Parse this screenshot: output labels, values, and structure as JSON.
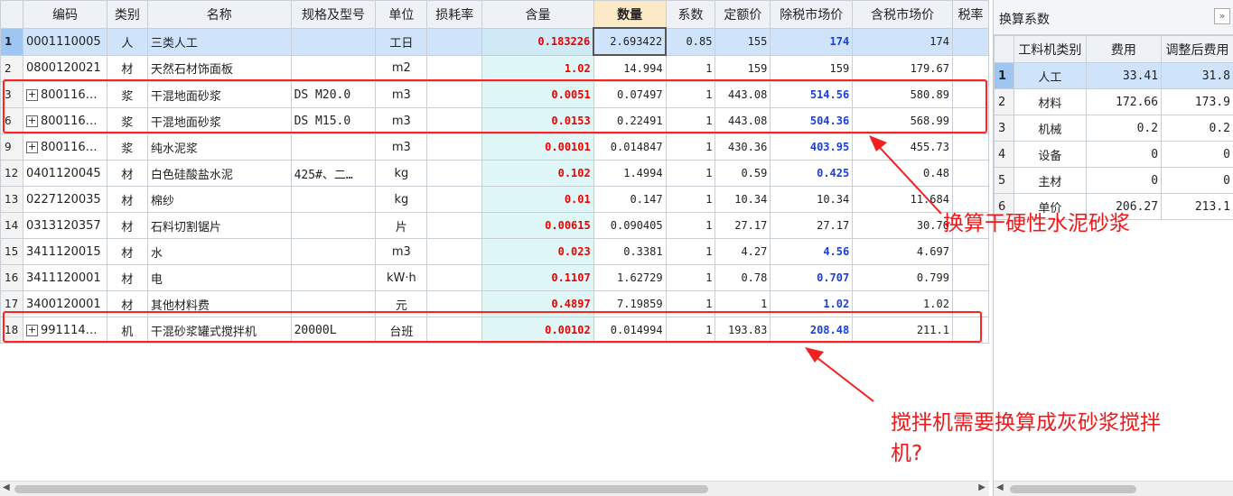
{
  "table": {
    "headers": [
      "编码",
      "类别",
      "名称",
      "规格及型号",
      "单位",
      "损耗率",
      "含量",
      "数量",
      "系数",
      "定额价",
      "除税市场价",
      "含税市场价",
      "税率"
    ],
    "rows": [
      {
        "no": "1",
        "code": "0001110005",
        "expand": false,
        "type": "人",
        "name": "三类人工",
        "spec": "",
        "unit": "工日",
        "loss": "",
        "content": "0.183226",
        "qty": "2.693422",
        "coef": "0.85",
        "quota": "155",
        "mkt_ex": "174",
        "mkt_ex_hl": true,
        "mkt_in": "174"
      },
      {
        "no": "2",
        "code": "0800120021",
        "expand": false,
        "type": "材",
        "name": "天然石材饰面板",
        "spec": "",
        "unit": "m2",
        "loss": "",
        "content": "1.02",
        "qty": "14.994",
        "coef": "1",
        "quota": "159",
        "mkt_ex": "159",
        "mkt_ex_hl": false,
        "mkt_in": "179.67"
      },
      {
        "no": "3",
        "code": "800116…",
        "expand": true,
        "type": "浆",
        "name": "干混地面砂浆",
        "spec": "DS M20.0",
        "unit": "m3",
        "loss": "",
        "content": "0.0051",
        "qty": "0.07497",
        "coef": "1",
        "quota": "443.08",
        "mkt_ex": "514.56",
        "mkt_ex_hl": true,
        "mkt_in": "580.89"
      },
      {
        "no": "6",
        "code": "800116…",
        "expand": true,
        "type": "浆",
        "name": "干混地面砂浆",
        "spec": "DS M15.0",
        "unit": "m3",
        "loss": "",
        "content": "0.0153",
        "qty": "0.22491",
        "coef": "1",
        "quota": "443.08",
        "mkt_ex": "504.36",
        "mkt_ex_hl": true,
        "mkt_in": "568.99"
      },
      {
        "no": "9",
        "code": "800116…",
        "expand": true,
        "type": "浆",
        "name": "纯水泥浆",
        "spec": "",
        "unit": "m3",
        "loss": "",
        "content": "0.00101",
        "qty": "0.014847",
        "coef": "1",
        "quota": "430.36",
        "mkt_ex": "403.95",
        "mkt_ex_hl": true,
        "mkt_in": "455.73"
      },
      {
        "no": "12",
        "code": "0401120045",
        "expand": false,
        "type": "材",
        "name": "白色硅酸盐水泥",
        "spec": "425#、二…",
        "unit": "kg",
        "loss": "",
        "content": "0.102",
        "qty": "1.4994",
        "coef": "1",
        "quota": "0.59",
        "mkt_ex": "0.425",
        "mkt_ex_hl": true,
        "mkt_in": "0.48"
      },
      {
        "no": "13",
        "code": "0227120035",
        "expand": false,
        "type": "材",
        "name": "棉纱",
        "spec": "",
        "unit": "kg",
        "loss": "",
        "content": "0.01",
        "qty": "0.147",
        "coef": "1",
        "quota": "10.34",
        "mkt_ex": "10.34",
        "mkt_ex_hl": false,
        "mkt_in": "11.684"
      },
      {
        "no": "14",
        "code": "0313120357",
        "expand": false,
        "type": "材",
        "name": "石料切割锯片",
        "spec": "",
        "unit": "片",
        "loss": "",
        "content": "0.00615",
        "qty": "0.090405",
        "coef": "1",
        "quota": "27.17",
        "mkt_ex": "27.17",
        "mkt_ex_hl": false,
        "mkt_in": "30.70"
      },
      {
        "no": "15",
        "code": "3411120015",
        "expand": false,
        "type": "材",
        "name": "水",
        "spec": "",
        "unit": "m3",
        "loss": "",
        "content": "0.023",
        "qty": "0.3381",
        "coef": "1",
        "quota": "4.27",
        "mkt_ex": "4.56",
        "mkt_ex_hl": true,
        "mkt_in": "4.697"
      },
      {
        "no": "16",
        "code": "3411120001",
        "expand": false,
        "type": "材",
        "name": "电",
        "spec": "",
        "unit": "kW·h",
        "loss": "",
        "content": "0.1107",
        "qty": "1.62729",
        "coef": "1",
        "quota": "0.78",
        "mkt_ex": "0.707",
        "mkt_ex_hl": true,
        "mkt_in": "0.799"
      },
      {
        "no": "17",
        "code": "3400120001",
        "expand": false,
        "type": "材",
        "name": "其他材料费",
        "spec": "",
        "unit": "元",
        "loss": "",
        "content": "0.4897",
        "qty": "7.19859",
        "coef": "1",
        "quota": "1",
        "mkt_ex": "1.02",
        "mkt_ex_hl": true,
        "mkt_in": "1.02"
      },
      {
        "no": "18",
        "code": "991114…",
        "expand": true,
        "type": "机",
        "name": "干混砂浆罐式搅拌机",
        "spec": "20000L",
        "unit": "台班",
        "loss": "",
        "content": "0.00102",
        "qty": "0.014994",
        "coef": "1",
        "quota": "193.83",
        "mkt_ex": "208.48",
        "mkt_ex_hl": true,
        "mkt_in": "211.1"
      }
    ]
  },
  "panel": {
    "title": "换算系数",
    "collapse_icon": "»",
    "headers": [
      "工料机类别",
      "费用",
      "调整后费用"
    ],
    "rows": [
      {
        "no": "1",
        "cat": "人工",
        "fee": "33.41",
        "adj": "31.8"
      },
      {
        "no": "2",
        "cat": "材料",
        "fee": "172.66",
        "adj": "173.9"
      },
      {
        "no": "3",
        "cat": "机械",
        "fee": "0.2",
        "adj": "0.2"
      },
      {
        "no": "4",
        "cat": "设备",
        "fee": "0",
        "adj": "0"
      },
      {
        "no": "5",
        "cat": "主材",
        "fee": "0",
        "adj": "0"
      },
      {
        "no": "6",
        "cat": "单价",
        "fee": "206.27",
        "adj": "213.1"
      }
    ]
  },
  "annotations": {
    "note1": "换算干硬性水泥砂浆",
    "note2_line1": "搅拌机需要换算成灰砂浆搅拌",
    "note2_line2": "机?"
  },
  "colors": {
    "annotation": "#f22020",
    "highlight_red": "#e00000",
    "highlight_blue": "#1a3ee0",
    "selected_row": "#cfe3fb"
  }
}
